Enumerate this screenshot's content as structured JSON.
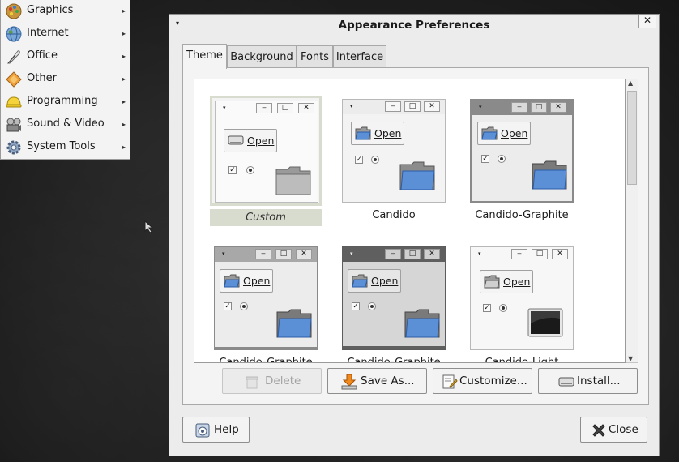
{
  "menu": {
    "items": [
      {
        "label": "Graphics",
        "icon": "graphics-palette-icon"
      },
      {
        "label": "Internet",
        "icon": "globe-icon"
      },
      {
        "label": "Office",
        "icon": "quill-pen-icon"
      },
      {
        "label": "Other",
        "icon": "diamond-icon"
      },
      {
        "label": "Programming",
        "icon": "hard-hat-icon"
      },
      {
        "label": "Sound & Video",
        "icon": "film-camera-icon"
      },
      {
        "label": "System Tools",
        "icon": "gear-icon"
      }
    ],
    "submenu_arrow": "▸"
  },
  "dialog": {
    "title": "Appearance Preferences",
    "close_glyph": "✕",
    "menu_glyph": "▾",
    "tabs": [
      {
        "label": "Theme",
        "active": true
      },
      {
        "label": "Background",
        "active": false
      },
      {
        "label": "Fonts",
        "active": false
      },
      {
        "label": "Interface",
        "active": false
      }
    ],
    "themes": [
      {
        "name": "Custom",
        "selected": true
      },
      {
        "name": "Candido",
        "selected": false
      },
      {
        "name": "Candido-Graphite",
        "selected": false
      },
      {
        "name": "Candido-Graphite",
        "selected": false
      },
      {
        "name": "Candido-Graphite",
        "selected": false
      },
      {
        "name": "Candido-Light",
        "selected": false
      }
    ],
    "preview": {
      "open_label": "Open",
      "minimize_glyph": "‒",
      "maximize_glyph": "□",
      "close_glyph": "✕",
      "check_glyph": "✓"
    },
    "actions": {
      "delete": "Delete",
      "save_as": "Save As...",
      "customize": "Customize...",
      "install": "Install..."
    },
    "help_label": "Help",
    "close_label": "Close",
    "colors": {
      "selection": "#d8dccf",
      "folder_blue": "#5b8fd6",
      "graphite_frame": "#8a8a8a"
    }
  }
}
